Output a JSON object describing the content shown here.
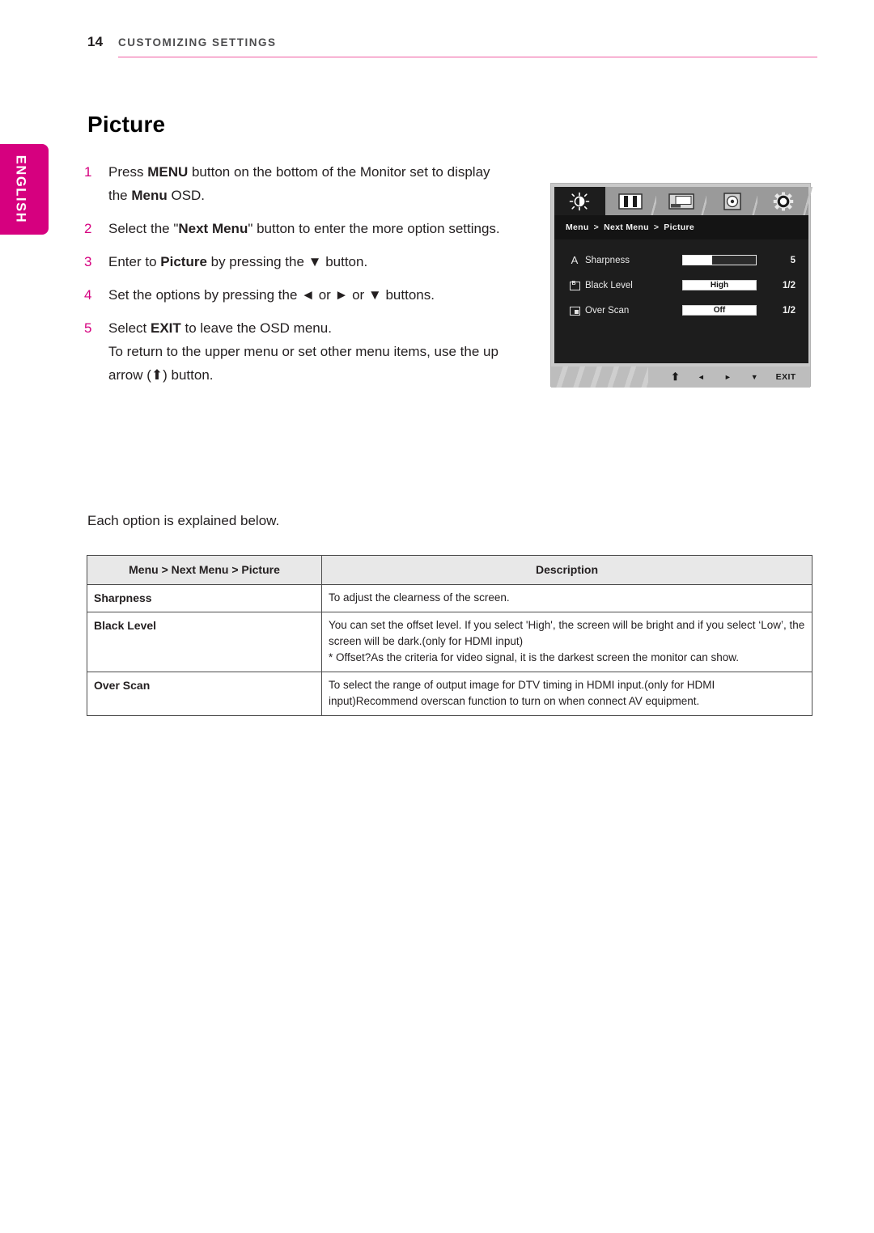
{
  "header": {
    "page_number": "14",
    "section": "CUSTOMIZING SETTINGS",
    "rule_color": "#ef5ba1"
  },
  "language_tab": {
    "label": "ENGLISH",
    "color": "#d6007f"
  },
  "section_title": "Picture",
  "steps": [
    {
      "num": "1",
      "parts": [
        {
          "t": "Press ",
          "b": false
        },
        {
          "t": "MENU",
          "b": true
        },
        {
          "t": " button on the bottom of the Monitor set to display the ",
          "b": false
        },
        {
          "t": "Menu",
          "b": true
        },
        {
          "t": " OSD.",
          "b": false
        }
      ]
    },
    {
      "num": "2",
      "parts": [
        {
          "t": "Select the \"",
          "b": false
        },
        {
          "t": "Next Menu",
          "b": true
        },
        {
          "t": "\" button to enter the more option settings.",
          "b": false
        }
      ]
    },
    {
      "num": "3",
      "parts": [
        {
          "t": "Enter to ",
          "b": false
        },
        {
          "t": "Picture",
          "b": true
        },
        {
          "t": " by pressing the ▼ button.",
          "b": false
        }
      ]
    },
    {
      "num": "4",
      "parts": [
        {
          "t": "Set the options by pressing the ◄ or ► or ▼ buttons.",
          "b": false
        }
      ]
    },
    {
      "num": "5",
      "parts": [
        {
          "t": "Select ",
          "b": false
        },
        {
          "t": "EXIT",
          "b": true
        },
        {
          "t": " to leave the OSD menu.",
          "b": false
        }
      ],
      "sub": "To return to the upper menu or set other menu items, use the up arrow (⬆) button."
    }
  ],
  "osd": {
    "tabs": [
      {
        "icon": "brightness-contrast-icon",
        "active": true
      },
      {
        "icon": "color-bars-icon",
        "active": false
      },
      {
        "icon": "screen-position-icon",
        "active": false
      },
      {
        "icon": "disc-source-icon",
        "active": false
      },
      {
        "icon": "gear-settings-icon",
        "active": false
      }
    ],
    "breadcrumb": {
      "root": "Menu",
      "mid": "Next Menu",
      "leaf": "Picture",
      "sep": ">"
    },
    "rows": [
      {
        "icon": "letter-a-icon",
        "label": "Sharpness",
        "control": "slider",
        "fill_percent": 40,
        "value": "5"
      },
      {
        "icon": "black-level-icon",
        "label": "Black Level",
        "control": "pill",
        "option": "High",
        "value": "1/2"
      },
      {
        "icon": "over-scan-icon",
        "label": "Over Scan",
        "control": "pill",
        "option": "Off",
        "value": "1/2"
      }
    ],
    "bottom_buttons": [
      {
        "name": "up-arrow-button",
        "glyph": "⬆"
      },
      {
        "name": "left-arrow-button",
        "glyph": "◄"
      },
      {
        "name": "right-arrow-button",
        "glyph": "►"
      },
      {
        "name": "down-arrow-button",
        "glyph": "▼"
      },
      {
        "name": "exit-button",
        "glyph": "EXIT"
      }
    ]
  },
  "explain_line": "Each option is explained below.",
  "table": {
    "headers": [
      "Menu > Next Menu > Picture",
      "Description"
    ],
    "rows": [
      {
        "key": "Sharpness",
        "desc": "To adjust the clearness of the screen."
      },
      {
        "key": "Black Level",
        "desc": "You can set the offset level. If you select 'High', the screen will be bright and if you select ‘Low’, the screen will be dark.(only for HDMI input)\n* Offset?As the criteria for video signal, it is the darkest screen the monitor can show."
      },
      {
        "key": "Over Scan",
        "desc": "To select the range of output image for DTV timing in HDMI input.(only for HDMI input)Recommend overscan function to turn on when connect AV equipment."
      }
    ]
  }
}
